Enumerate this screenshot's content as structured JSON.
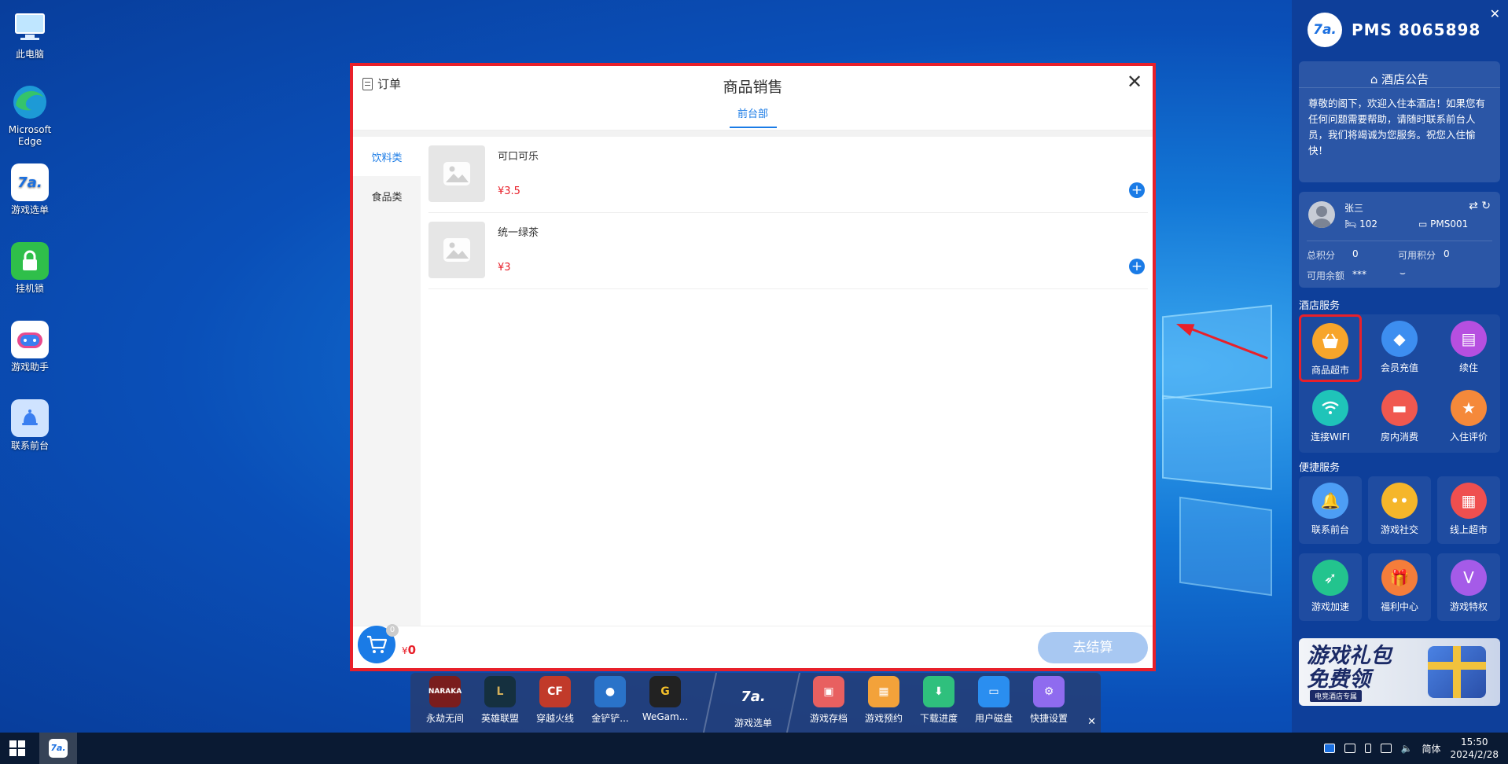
{
  "desktop": {
    "icons": [
      {
        "label": "此电脑",
        "icon": "computer-icon"
      },
      {
        "label": "Microsoft Edge",
        "icon": "edge-icon"
      },
      {
        "label": "游戏选单",
        "icon": "game-menu-icon"
      },
      {
        "label": "挂机锁",
        "icon": "lock-icon"
      },
      {
        "label": "游戏助手",
        "icon": "game-assistant-icon"
      },
      {
        "label": "联系前台",
        "icon": "bell-icon"
      }
    ]
  },
  "dialog": {
    "order_label": "订单",
    "title": "商品销售",
    "dept_tab": "前台部",
    "categories": [
      {
        "label": "饮料类",
        "active": true
      },
      {
        "label": "食品类",
        "active": false
      }
    ],
    "products": [
      {
        "name": "可口可乐",
        "price": "¥3.5"
      },
      {
        "name": "统一绿茶",
        "price": "¥3"
      }
    ],
    "cart_count": "0",
    "total_symbol": "¥",
    "total_value": "0",
    "checkout_label": "去结算"
  },
  "panel": {
    "title": "PMS 8065898",
    "notice_title": "酒店公告",
    "notice_text": "尊敬的阁下，欢迎入住本酒店！如果您有任何问题需要帮助，请随时联系前台人员，我们将竭诚为您服务。祝您入住愉快！",
    "user": {
      "name": "张三",
      "room": "102",
      "pms": "PMS001",
      "total_points_label": "总积分",
      "total_points": "0",
      "available_points_label": "可用积分",
      "available_points": "0",
      "balance_label": "可用余额",
      "balance": "***"
    },
    "hotel_services_label": "酒店服务",
    "hotel_services": [
      {
        "label": "商品超市",
        "icon": "basket-icon",
        "color": "#f7a52b"
      },
      {
        "label": "会员充值",
        "icon": "diamond-icon",
        "color": "#3d8ef0"
      },
      {
        "label": "续住",
        "icon": "bed-icon",
        "color": "#b64fe0"
      },
      {
        "label": "连接WIFI",
        "icon": "wifi-icon",
        "color": "#1fc4b9"
      },
      {
        "label": "房内消费",
        "icon": "card-icon",
        "color": "#f0584f"
      },
      {
        "label": "入住评价",
        "icon": "star-icon",
        "color": "#f5893a"
      }
    ],
    "quick_services_label": "便捷服务",
    "quick_services": [
      {
        "label": "联系前台",
        "icon": "bell-icon",
        "color": "#4d9ef5"
      },
      {
        "label": "游戏社交",
        "icon": "chat-icon",
        "color": "#f5b62a"
      },
      {
        "label": "线上超市",
        "icon": "shop-icon",
        "color": "#ef4f4f"
      },
      {
        "label": "游戏加速",
        "icon": "rocket-icon",
        "color": "#23c48e"
      },
      {
        "label": "福利中心",
        "icon": "gift-icon",
        "color": "#f57d3a"
      },
      {
        "label": "游戏特权",
        "icon": "vip-icon",
        "color": "#a55be8"
      }
    ],
    "promo_main": "游戏礼包 免费领",
    "promo_sub": "电竞酒店专属"
  },
  "dock": {
    "items": [
      {
        "label": "永劫无间",
        "icon": "naraka-icon",
        "color": "#7a1d1d"
      },
      {
        "label": "英雄联盟",
        "icon": "lol-icon",
        "color": "#15303f"
      },
      {
        "label": "穿越火线",
        "icon": "cf-icon",
        "color": "#c13a2a"
      },
      {
        "label": "金铲铲...",
        "icon": "jcc-icon",
        "color": "#2a73c9"
      },
      {
        "label": "WeGam...",
        "icon": "wegame-icon",
        "color": "#222"
      },
      {
        "label": "游戏选单",
        "icon": "game-menu-icon",
        "color": "#1a6fe0"
      },
      {
        "label": "游戏存档",
        "icon": "save-icon",
        "color": "#e86060"
      },
      {
        "label": "游戏预约",
        "icon": "calendar-icon",
        "color": "#f3a23a"
      },
      {
        "label": "下载进度",
        "icon": "download-icon",
        "color": "#2fc07d"
      },
      {
        "label": "用户磁盘",
        "icon": "disk-icon",
        "color": "#2a8ef0"
      },
      {
        "label": "快捷设置",
        "icon": "settings-icon",
        "color": "#8f6bef"
      }
    ]
  },
  "taskbar": {
    "ime": "简体",
    "time": "15:50",
    "date": "2024/2/28"
  }
}
